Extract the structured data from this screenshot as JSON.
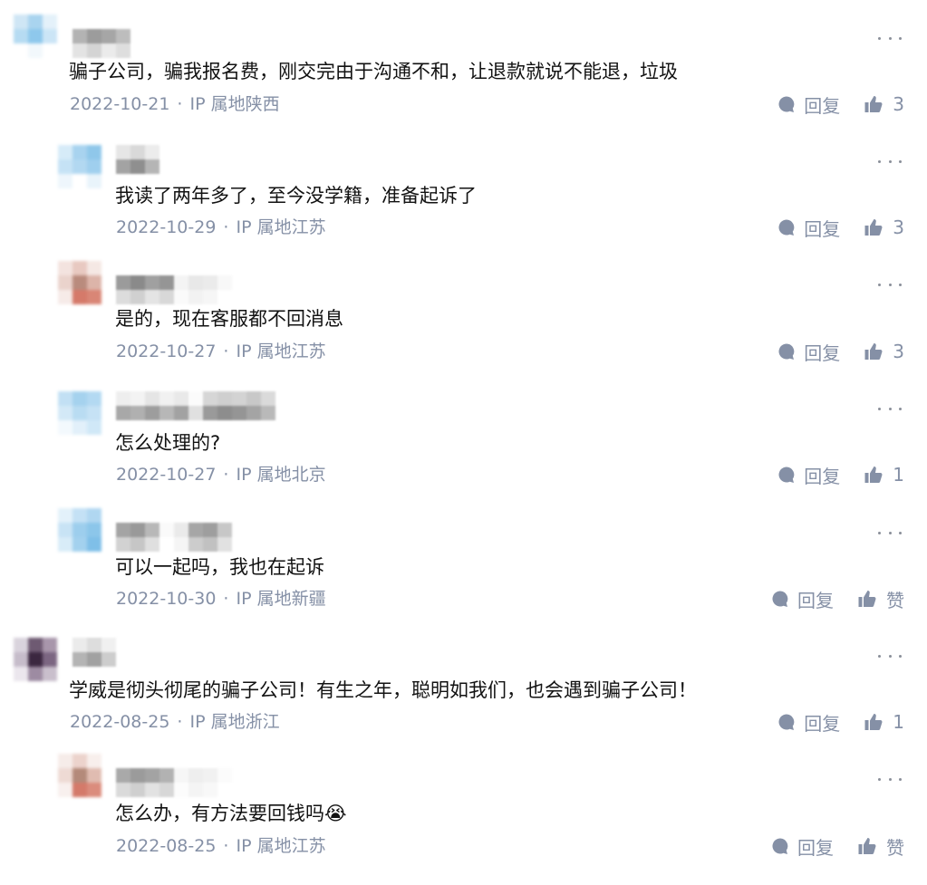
{
  "comments": [
    {
      "content": "骗子公司，骗我报名费，刚交完由于沟通不和，让退款就说不能退，垃圾",
      "date": "2022-10-21",
      "ip_label": "IP 属地陕西",
      "reply_label": "回复",
      "like_label": "3"
    },
    {
      "content": "我读了两年多了，至今没学籍，准备起诉了",
      "date": "2022-10-29",
      "ip_label": "IP 属地江苏",
      "reply_label": "回复",
      "like_label": "3"
    },
    {
      "content": "是的，现在客服都不回消息",
      "date": "2022-10-27",
      "ip_label": "IP 属地江苏",
      "reply_label": "回复",
      "like_label": "3"
    },
    {
      "content": "怎么处理的?",
      "date": "2022-10-27",
      "ip_label": "IP 属地北京",
      "reply_label": "回复",
      "like_label": "1"
    },
    {
      "content": "可以一起吗，我也在起诉",
      "date": "2022-10-30",
      "ip_label": "IP 属地新疆",
      "reply_label": "回复",
      "like_label": "赞"
    },
    {
      "content": "学威是彻头彻尾的骗子公司！有生之年，聪明如我们，也会遇到骗子公司！",
      "date": "2022-08-25",
      "ip_label": "IP 属地浙江",
      "reply_label": "回复",
      "like_label": "1"
    },
    {
      "content": "怎么办，有方法要回钱吗😭",
      "date": "2022-08-25",
      "ip_label": "IP 属地江苏",
      "reply_label": "回复",
      "like_label": "赞"
    }
  ],
  "meta_separator": "·",
  "icons": {
    "reply": "reply-bubble-icon",
    "like": "thumbs-up-icon",
    "more": "more-dots-icon"
  },
  "colors": {
    "text": "#121212",
    "meta": "#8590a6",
    "icon": "#8590a6",
    "more_dots": "#8a8f99"
  }
}
